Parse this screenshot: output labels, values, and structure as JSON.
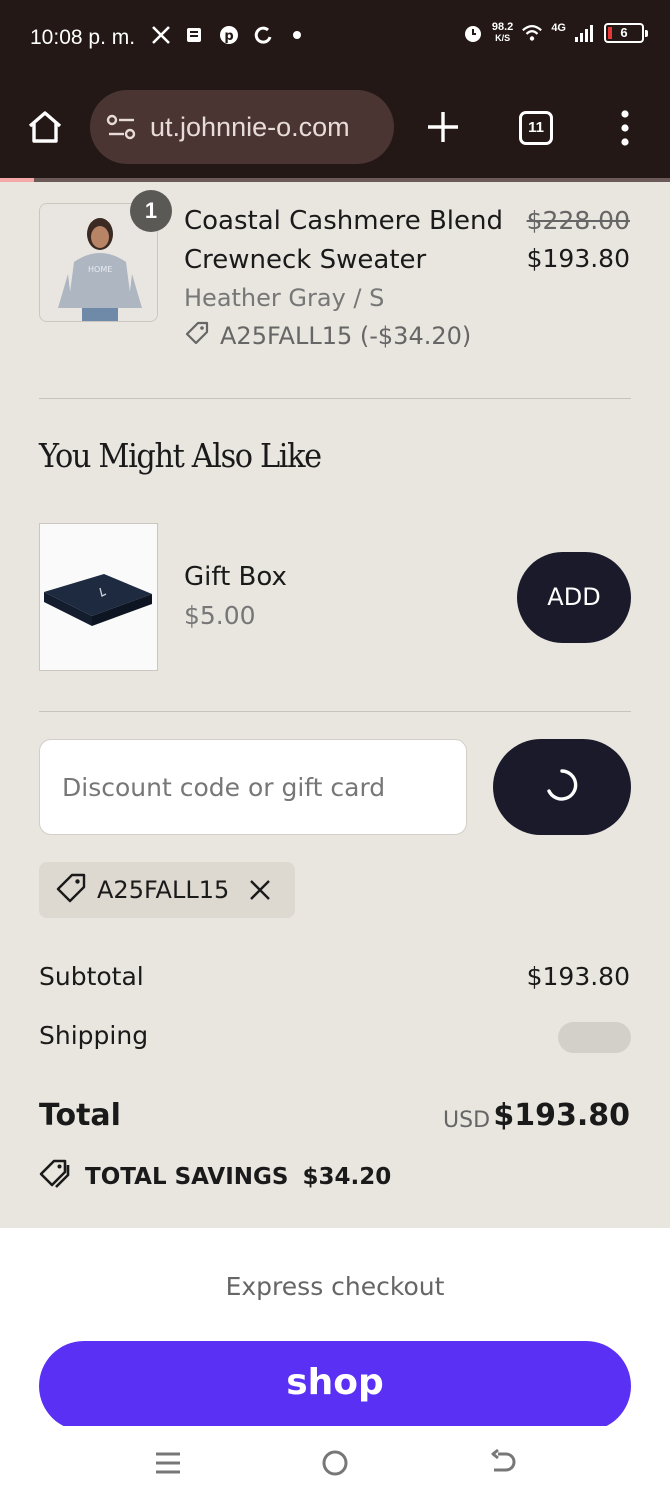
{
  "status_bar": {
    "time": "10:08 p. m.",
    "net_speed_value": "98.2",
    "net_speed_unit": "K/S",
    "network": "4G",
    "battery": "6"
  },
  "browser": {
    "url": "ut.johnnie-o.com",
    "tab_count": "11",
    "load_progress": 0.05
  },
  "cart_item": {
    "quantity": "1",
    "name": "Coastal Cashmere Blend Crewneck Sweater",
    "variant": "Heather Gray / S",
    "discount": "A25FALL15 (-$34.20)",
    "original_price": "$228.00",
    "price": "$193.80"
  },
  "upsell": {
    "title": "You Might Also Like",
    "name": "Gift Box",
    "price": "$5.00",
    "add_label": "ADD"
  },
  "discount": {
    "placeholder": "Discount code or gift card",
    "applied_code": "A25FALL15"
  },
  "summary": {
    "subtotal_label": "Subtotal",
    "subtotal_value": "$193.80",
    "shipping_label": "Shipping",
    "total_label": "Total",
    "currency": "USD",
    "total_value": "$193.80",
    "savings_label": "TOTAL SAVINGS",
    "savings_value": "$34.20"
  },
  "checkout": {
    "express_label": "Express checkout",
    "shop_label": "shop"
  },
  "colors": {
    "dark_button": "#1b1a2b",
    "shop_purple": "#5a31f4",
    "page_bg": "#e9e5df"
  }
}
